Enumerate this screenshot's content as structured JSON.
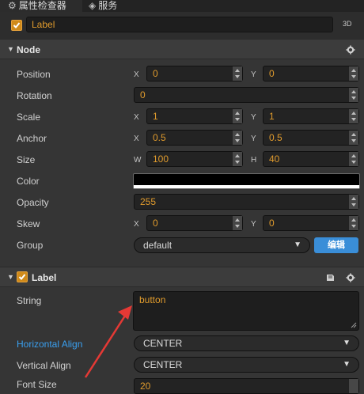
{
  "tabs": [
    {
      "label": "属性检查器",
      "icon": "gear-icon"
    },
    {
      "label": "服务",
      "icon": "cloud-service-icon"
    }
  ],
  "node": {
    "name": "Label",
    "enabled": true,
    "tag_3d": "3D"
  },
  "node_section": {
    "title": "Node",
    "props": {
      "position": {
        "label": "Position",
        "x_axis": "X",
        "x": "0",
        "y_axis": "Y",
        "y": "0"
      },
      "rotation": {
        "label": "Rotation",
        "value": "0"
      },
      "scale": {
        "label": "Scale",
        "x_axis": "X",
        "x": "1",
        "y_axis": "Y",
        "y": "1"
      },
      "anchor": {
        "label": "Anchor",
        "x_axis": "X",
        "x": "0.5",
        "y_axis": "Y",
        "y": "0.5"
      },
      "size": {
        "label": "Size",
        "w_axis": "W",
        "w": "100",
        "h_axis": "H",
        "h": "40"
      },
      "color": {
        "label": "Color",
        "value": "#000000"
      },
      "opacity": {
        "label": "Opacity",
        "value": "255"
      },
      "skew": {
        "label": "Skew",
        "x_axis": "X",
        "x": "0",
        "y_axis": "Y",
        "y": "0"
      },
      "group": {
        "label": "Group",
        "value": "default",
        "edit_label": "编辑"
      }
    }
  },
  "label_section": {
    "title": "Label",
    "enabled": true,
    "props": {
      "string": {
        "label": "String",
        "value": "button"
      },
      "horizontal_align": {
        "label": "Horizontal Align",
        "value": "CENTER"
      },
      "vertical_align": {
        "label": "Vertical Align",
        "value": "CENTER"
      },
      "font_size": {
        "label": "Font Size",
        "value": "20"
      }
    }
  },
  "colors": {
    "accent_orange": "#e09b2d",
    "link_blue": "#3a8ed8",
    "annotation_red": "#e53935"
  }
}
